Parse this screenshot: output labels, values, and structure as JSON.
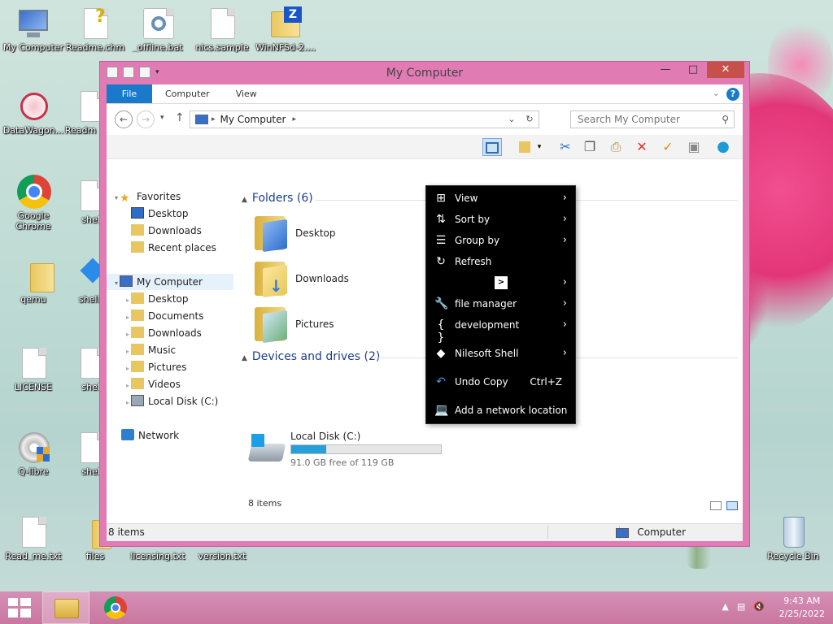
{
  "desktop": {
    "icons": [
      {
        "label": "My Computer"
      },
      {
        "label": "Readme.chm"
      },
      {
        "label": "_offline.bat"
      },
      {
        "label": "nics.sample"
      },
      {
        "label": "WinNFSd-2...."
      },
      {
        "label": "DataWagon..."
      },
      {
        "label": "Readm"
      },
      {
        "label": "Google Chrome"
      },
      {
        "label": "shell"
      },
      {
        "label": "qemu"
      },
      {
        "label": "shell."
      },
      {
        "label": "LICENSE"
      },
      {
        "label": "shell"
      },
      {
        "label": "Q-libre"
      },
      {
        "label": "shell"
      },
      {
        "label": "Read_me.txt"
      },
      {
        "label": "files"
      },
      {
        "label": "licensing.txt"
      },
      {
        "label": "version.txt"
      },
      {
        "label": "Recycle Bin"
      }
    ]
  },
  "window": {
    "title": "My Computer",
    "ribbon_tabs": [
      "File",
      "Computer",
      "View"
    ],
    "address": {
      "crumb": "My Computer"
    },
    "search_placeholder": "Search My Computer",
    "nav": {
      "favorites": "Favorites",
      "fav_items": [
        "Desktop",
        "Downloads",
        "Recent places"
      ],
      "my_computer": "My Computer",
      "pc_items": [
        "Desktop",
        "Documents",
        "Downloads",
        "Music",
        "Pictures",
        "Videos",
        "Local Disk (C:)"
      ],
      "network": "Network"
    },
    "groups": {
      "folders": "Folders (6)",
      "folder_items": [
        "Desktop",
        "Downloads",
        "Pictures"
      ],
      "devices": "Devices and drives (2)"
    },
    "drive": {
      "name": "Local Disk (C:)",
      "free": "91.0 GB free of 119 GB",
      "used_fraction": 0.235
    },
    "status_items": "8 items",
    "statusbar": {
      "left": "8 items",
      "right": "Computer"
    }
  },
  "context_menu": {
    "items": [
      {
        "label": "View",
        "icon": "grid-icon",
        "submenu": true
      },
      {
        "label": "Sort by",
        "icon": "sort-icon",
        "submenu": true
      },
      {
        "label": "Group by",
        "icon": "group-icon",
        "submenu": true
      },
      {
        "label": "Refresh",
        "icon": "refresh-icon",
        "submenu": false
      },
      {
        "label": "",
        "icon": "terminal-icon",
        "submenu": true
      },
      {
        "label": "file manager",
        "icon": "wrench-icon",
        "submenu": true
      },
      {
        "label": "development",
        "icon": "braces-icon",
        "submenu": true
      },
      {
        "label": "Nilesoft Shell",
        "icon": "nilesoft-icon",
        "submenu": true
      },
      {
        "label": "Undo Copy",
        "icon": "undo-icon",
        "shortcut": "Ctrl+Z"
      },
      {
        "label": "Add a network location",
        "icon": "network-location-icon"
      }
    ]
  },
  "taskbar": {
    "time": "9:43 AM",
    "date": "2/25/2022"
  }
}
